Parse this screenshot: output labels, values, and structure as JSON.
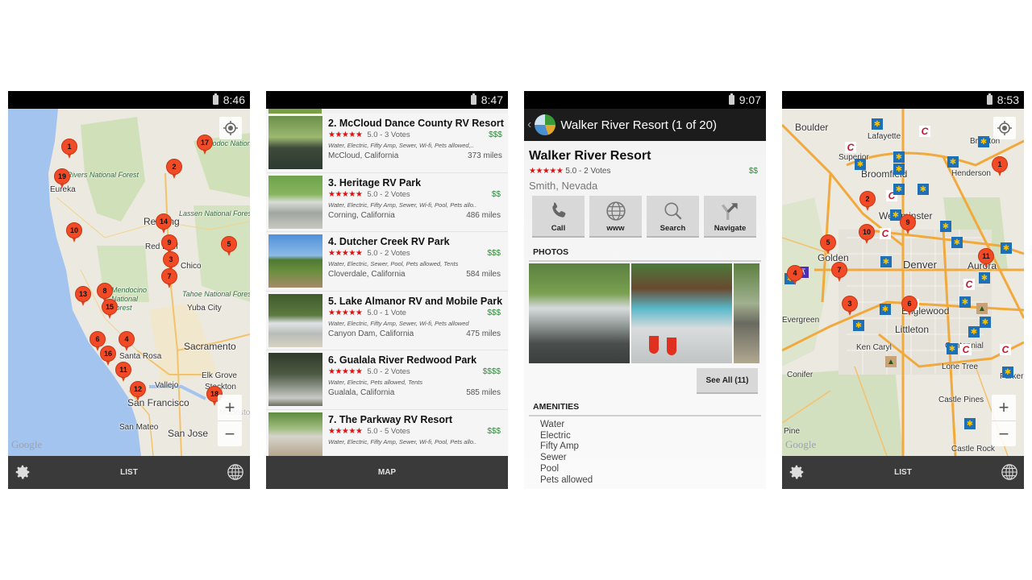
{
  "screens": {
    "map_california": {
      "status_time": "8:46",
      "bottom_label": "LIST",
      "zoom_in": "+",
      "zoom_out": "−",
      "google_logo": "Google",
      "pins": [
        "1",
        "17",
        "2",
        "19",
        "14",
        "10",
        "9",
        "5",
        "3",
        "7",
        "13",
        "8",
        "15",
        "6",
        "4",
        "16",
        "11",
        "12",
        "18"
      ],
      "labels": [
        "Six Rivers National Forest",
        "Eureka",
        "Redding",
        "Red Bluff",
        "Lassen National Forest",
        "Modoc National Forest",
        "Chico",
        "Mendocino National Forest",
        "Tahoe National Forest",
        "Yuba City",
        "Sacramento",
        "Santa Rosa",
        "Elk Grove",
        "Vallejo",
        "Stockton",
        "San Francisco",
        "Modesto",
        "San Mateo",
        "San Jose"
      ]
    },
    "list": {
      "status_time": "8:47",
      "bottom_label": "MAP",
      "items": [
        {
          "name": "2. McCloud Dance County RV Resort",
          "rating": "★★★★★",
          "votes": "5.0 - 3 Votes",
          "price": "$$$",
          "amenities": "Water, Electric, Fifty Amp, Sewer, Wi-fi, Pets allowed,..",
          "location": "McCloud, California",
          "distance": "373 miles"
        },
        {
          "name": "3. Heritage RV Park",
          "rating": "★★★★★",
          "votes": "5.0 - 2 Votes",
          "price": "$$",
          "amenities": "Water, Electric, Fifty Amp, Sewer, Wi-fi, Pool, Pets allo..",
          "location": "Corning, California",
          "distance": "486 miles"
        },
        {
          "name": "4. Dutcher Creek RV Park",
          "rating": "★★★★★",
          "votes": "5.0 - 2 Votes",
          "price": "$$$",
          "amenities": "Water, Electric, Sewer, Pool, Pets allowed, Tents",
          "location": "Cloverdale, California",
          "distance": "584 miles"
        },
        {
          "name": "5. Lake Almanor RV and Mobile Park",
          "rating": "★★★★★",
          "votes": "5.0 - 1 Vote",
          "price": "$$$",
          "amenities": "Water, Electric, Fifty Amp, Sewer, Wi-fi, Pets allowed",
          "location": "Canyon Dam, California",
          "distance": "475 miles"
        },
        {
          "name": "6. Gualala River Redwood Park",
          "rating": "★★★★★",
          "votes": "5.0 - 2 Votes",
          "price": "$$$$",
          "amenities": "Water, Electric, Pets allowed, Tents",
          "location": "Gualala, California",
          "distance": "585 miles"
        },
        {
          "name": "7. The Parkway RV Resort",
          "rating": "★★★★★",
          "votes": "5.0 - 5 Votes",
          "price": "$$$",
          "amenities": "Water, Electric, Fifty Amp, Sewer, Wi-fi, Pool, Pets allo..",
          "location": "",
          "distance": ""
        }
      ]
    },
    "detail": {
      "status_time": "9:07",
      "back_glyph": "‹",
      "actionbar_title": "Walker River Resort (1 of 20)",
      "title": "Walker River Resort",
      "rating": "★★★★★",
      "votes": "5.0 - 2 Votes",
      "price": "$$",
      "city": "Smith, Nevada",
      "actions": [
        "Call",
        "www",
        "Search",
        "Navigate"
      ],
      "photos_header": "PHOTOS",
      "see_all": "See All (11)",
      "amenities_header": "AMENITIES",
      "amenities": [
        "Water",
        "Electric",
        "Fifty Amp",
        "Sewer",
        "Pool",
        "Pets allowed"
      ]
    },
    "map_denver": {
      "status_time": "8:53",
      "bottom_label": "LIST",
      "zoom_in": "+",
      "zoom_out": "−",
      "google_logo": "Google",
      "pins": [
        "1",
        "2",
        "9",
        "10",
        "5",
        "11",
        "7",
        "4",
        "3",
        "6"
      ],
      "labels": [
        "Boulder",
        "Lafayette",
        "Superior",
        "Broomfield",
        "Henderson",
        "Westminster",
        "Golden",
        "Denver",
        "Aurora",
        "Englewood",
        "Evergreen",
        "Littleton",
        "Ken Caryl",
        "Centennial",
        "Lone Tree",
        "Conifer",
        "Parker",
        "Castle Pines",
        "Pine",
        "Castle Rock",
        "Brighton"
      ]
    }
  },
  "colors": {
    "pin": "#f04a26",
    "star": "#e01010",
    "price": "#2f8a3a",
    "bottombar": "#3a3a3a",
    "actionbar": "#1c1c1c"
  }
}
